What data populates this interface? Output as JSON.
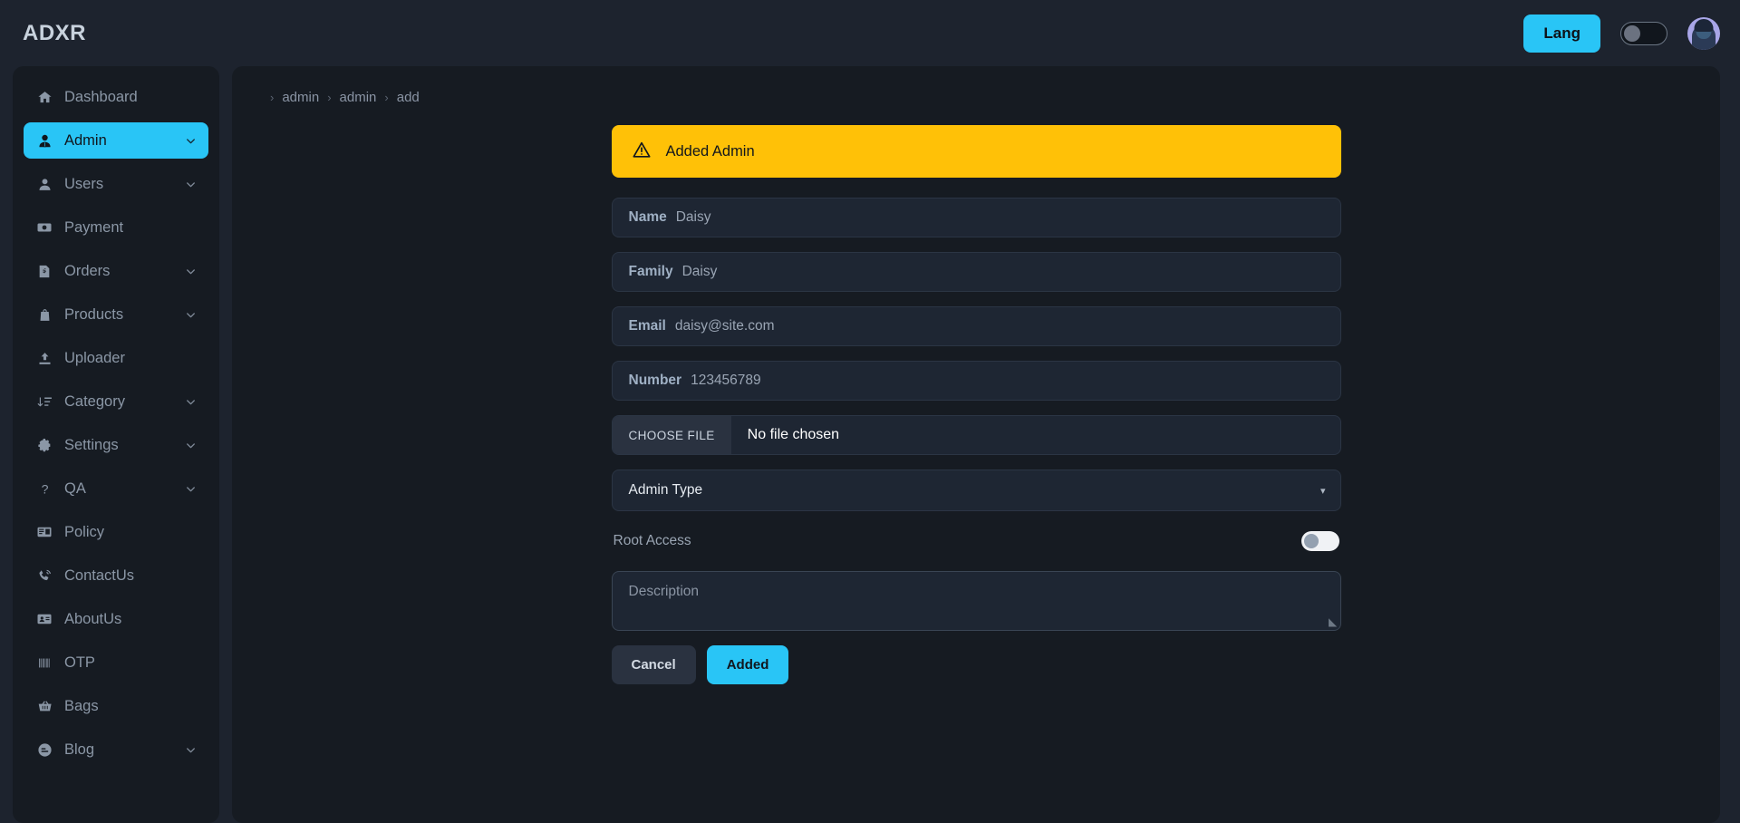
{
  "header": {
    "brand": "ADXR",
    "lang_label": "Lang",
    "theme_toggle_state": "off",
    "avatar_name": "user-avatar"
  },
  "sidebar": {
    "items": [
      {
        "label": "Dashboard",
        "icon": "home-icon",
        "expandable": false,
        "active": false
      },
      {
        "label": "Admin",
        "icon": "admin-user-icon",
        "expandable": true,
        "active": true
      },
      {
        "label": "Users",
        "icon": "user-icon",
        "expandable": true,
        "active": false
      },
      {
        "label": "Payment",
        "icon": "money-icon",
        "expandable": false,
        "active": false
      },
      {
        "label": "Orders",
        "icon": "receipt-icon",
        "expandable": true,
        "active": false
      },
      {
        "label": "Products",
        "icon": "bag-icon",
        "expandable": true,
        "active": false
      },
      {
        "label": "Uploader",
        "icon": "upload-icon",
        "expandable": false,
        "active": false
      },
      {
        "label": "Category",
        "icon": "sort-list-icon",
        "expandable": true,
        "active": false
      },
      {
        "label": "Settings",
        "icon": "gear-icon",
        "expandable": true,
        "active": false
      },
      {
        "label": "QA",
        "icon": "question-mark-icon",
        "expandable": true,
        "active": false
      },
      {
        "label": "Policy",
        "icon": "book-icon",
        "expandable": false,
        "active": false
      },
      {
        "label": "ContactUs",
        "icon": "phone-ring-icon",
        "expandable": false,
        "active": false
      },
      {
        "label": "AboutUs",
        "icon": "id-card-icon",
        "expandable": false,
        "active": false
      },
      {
        "label": "OTP",
        "icon": "barcode-icon",
        "expandable": false,
        "active": false
      },
      {
        "label": "Bags",
        "icon": "basket-icon",
        "expandable": false,
        "active": false
      },
      {
        "label": "Blog",
        "icon": "blogger-icon",
        "expandable": true,
        "active": false
      }
    ]
  },
  "breadcrumb": {
    "items": [
      "admin",
      "admin",
      "add"
    ],
    "separator": "›"
  },
  "alert": {
    "icon": "warning-triangle-icon",
    "message": "Added Admin",
    "color": "#ffc107"
  },
  "form": {
    "name": {
      "label": "Name",
      "value": "Daisy"
    },
    "family": {
      "label": "Family",
      "value": "Daisy"
    },
    "email": {
      "label": "Email",
      "value": "daisy@site.com"
    },
    "number": {
      "label": "Number",
      "value": "123456789"
    },
    "file": {
      "button_label": "CHOOSE FILE",
      "status": "No file chosen"
    },
    "admin_type": {
      "value": "Admin Type",
      "caret": "▾"
    },
    "root_access": {
      "label": "Root Access",
      "state": "off"
    },
    "description": {
      "placeholder": "Description",
      "value": ""
    },
    "cancel_label": "Cancel",
    "submit_label": "Added"
  },
  "theme": {
    "accent": "#29c5f6",
    "page_bg": "#1d232e",
    "panel_bg": "#161b22",
    "field_bg": "#1e2633",
    "warning": "#ffc107"
  }
}
